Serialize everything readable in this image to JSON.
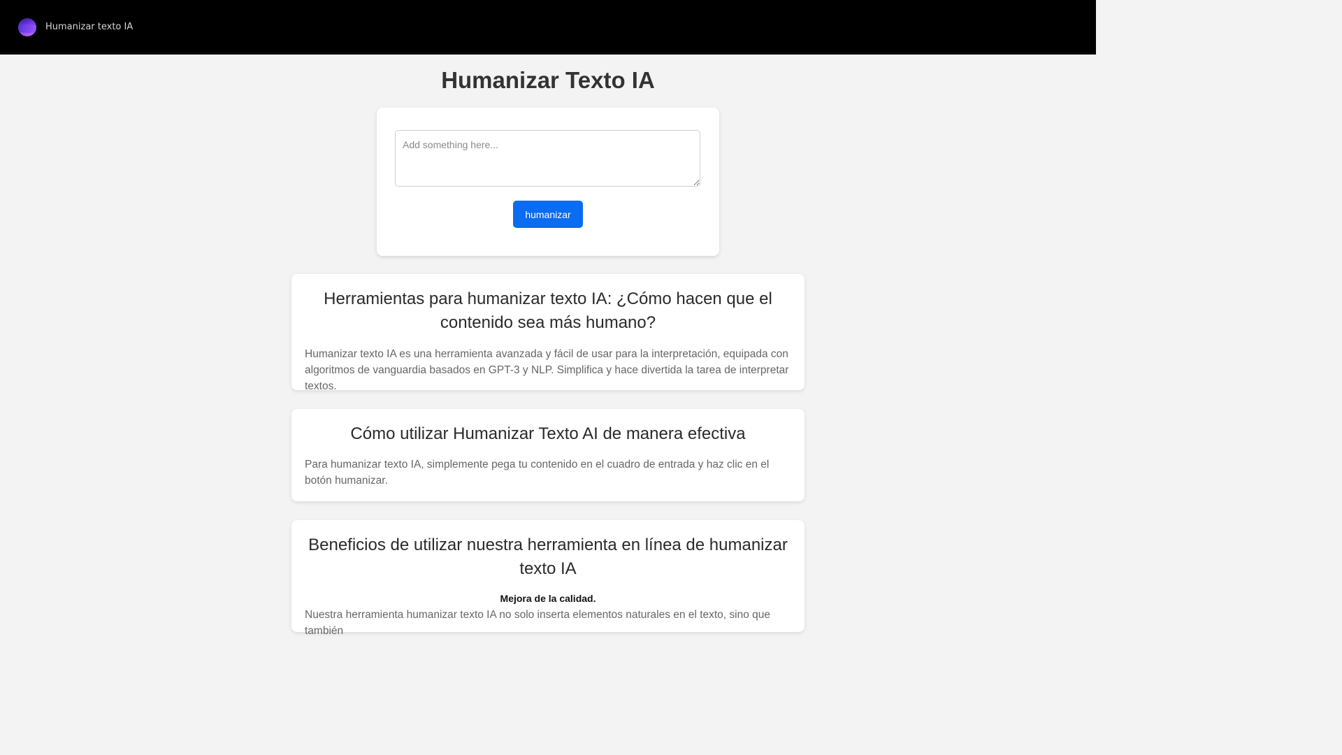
{
  "navbar": {
    "brand": "Humanizar texto IA",
    "logo_icon": "gradient-orb-icon"
  },
  "main": {
    "title": "Humanizar Texto IA",
    "input_placeholder": "Add something here...",
    "input_value": "",
    "button_label": "humanizar"
  },
  "sections": [
    {
      "heading": "Herramientas para humanizar texto IA: ¿Cómo hacen que el contenido sea más humano?",
      "text": "Humanizar texto IA es una herramienta avanzada y fácil de usar para la interpretación, equipada con algoritmos de vanguardia basados en GPT-3 y NLP. Simplifica y hace divertida la tarea de interpretar textos."
    },
    {
      "heading": "Cómo utilizar Humanizar Texto AI de manera efectiva",
      "text": "Para humanizar texto IA, simplemente pega tu contenido en el cuadro de entrada y haz clic en el botón humanizar."
    },
    {
      "heading": "Beneficios de utilizar nuestra herramienta en línea de humanizar texto IA",
      "subheading": "Mejora de la calidad.",
      "text": "Nuestra herramienta humanizar texto IA no solo inserta elementos naturales en el texto, sino que también"
    }
  ],
  "colors": {
    "navbar_bg": "#000000",
    "page_bg": "#f3f3f3",
    "button_bg": "#0a6cf0"
  }
}
